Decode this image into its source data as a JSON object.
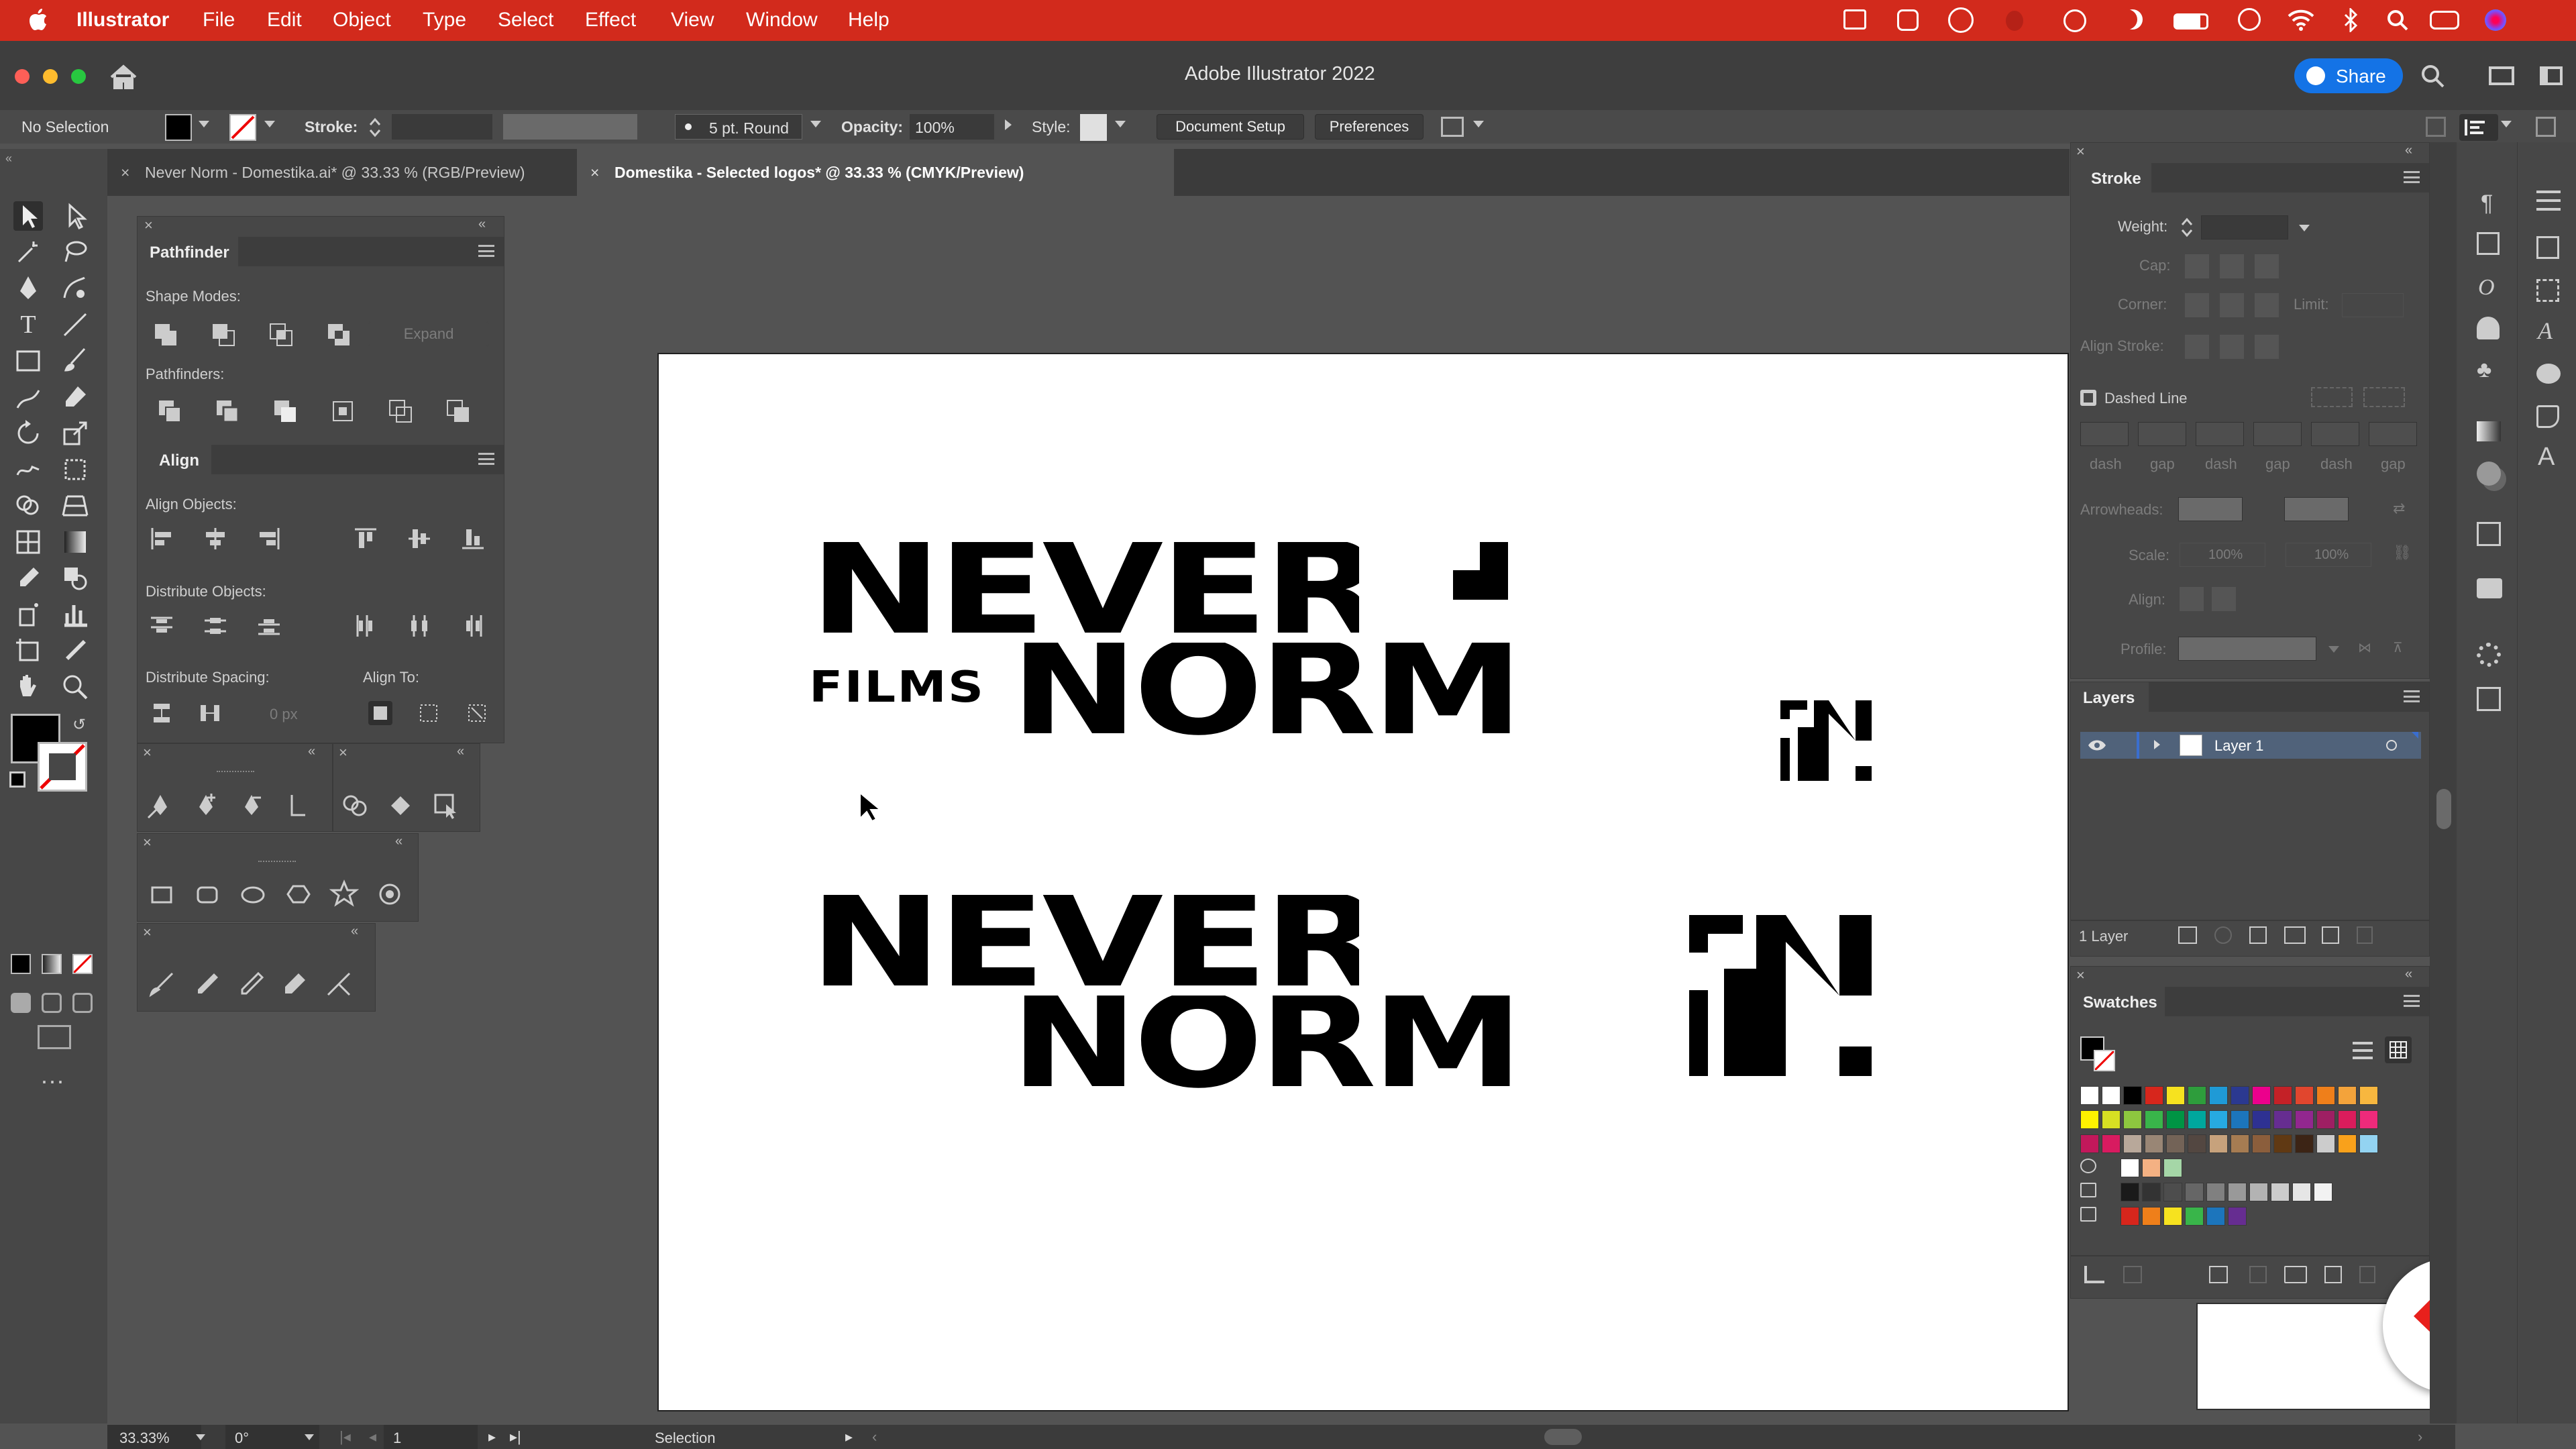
{
  "menubar": {
    "app": "Illustrator",
    "items": [
      "File",
      "Edit",
      "Object",
      "Type",
      "Select",
      "Effect",
      "View",
      "Window",
      "Help"
    ]
  },
  "window": {
    "title": "Adobe Illustrator 2022",
    "share_label": "Share"
  },
  "control_bar": {
    "selection": "No Selection",
    "stroke_label": "Stroke:",
    "brush": "5 pt. Round",
    "opacity_label": "Opacity:",
    "opacity_value": "100%",
    "style_label": "Style:",
    "document_setup": "Document Setup",
    "preferences": "Preferences"
  },
  "tabs": [
    {
      "label": "Never Norm - Domestika.ai* @ 33.33 % (RGB/Preview)",
      "active": false
    },
    {
      "label": "Domestika - Selected logos* @ 33.33 % (CMYK/Preview)",
      "active": true
    }
  ],
  "pathfinder": {
    "title": "Pathfinder",
    "shape_modes": "Shape Modes:",
    "expand": "Expand",
    "pathfinders": "Pathfinders:"
  },
  "align": {
    "title": "Align",
    "align_objects": "Align Objects:",
    "distribute_objects": "Distribute Objects:",
    "distribute_spacing": "Distribute Spacing:",
    "align_to": "Align To:",
    "spacing_value": "0 px"
  },
  "stroke_panel": {
    "title": "Stroke",
    "weight": "Weight:",
    "cap": "Cap:",
    "corner": "Corner:",
    "limit": "Limit:",
    "align_stroke": "Align Stroke:",
    "dashed_line": "Dashed Line",
    "dash_labels": [
      "dash",
      "gap",
      "dash",
      "gap",
      "dash",
      "gap"
    ],
    "arrowheads": "Arrowheads:",
    "scale": "Scale:",
    "scale_values": [
      "100%",
      "100%"
    ],
    "align": "Align:",
    "profile": "Profile:"
  },
  "layers": {
    "title": "Layers",
    "layer_name": "Layer 1",
    "count": "1 Layer"
  },
  "swatches": {
    "title": "Swatches",
    "rows": [
      [
        "#ffffff",
        "#ffffff",
        "#000000",
        "#d7261c",
        "#f6e21f",
        "#2e9d3c",
        "#1f9ad6",
        "#2b3990",
        "#ec008c",
        "#c42127",
        "#e1462e",
        "#ef7f1a",
        "#f3a33b",
        "#f7b73f"
      ],
      [
        "#fff200",
        "#d7df23",
        "#8dc63f",
        "#39b54a",
        "#009444",
        "#00a79d",
        "#27aae1",
        "#1c75bc",
        "#2e3192",
        "#662d91",
        "#92278f",
        "#9e1f63",
        "#da1c5c",
        "#ee2a7b"
      ],
      [
        "#c2185b",
        "#d81b60",
        "#b8a89a",
        "#998675",
        "#736357",
        "#534741",
        "#c7a27c",
        "#a67c52",
        "#8b5e3c",
        "#603913",
        "#3c2415",
        "#cccccc",
        "#f9a11b",
        "#93d3f1"
      ],
      [
        "#ffffff",
        "#f4b183",
        "#a5d6a7"
      ],
      [
        "#1a1a1a",
        "#333333",
        "#4d4d4d",
        "#666666",
        "#808080",
        "#999999",
        "#b3b3b3",
        "#cccccc",
        "#e6e6e6",
        "#f2f2f2"
      ],
      [
        "#d7261c",
        "#ef7f1a",
        "#f6e21f",
        "#39b54a",
        "#1c75bc",
        "#662d91"
      ]
    ]
  },
  "status_bar": {
    "zoom": "33.33%",
    "rotate": "0°",
    "artboard": "1",
    "tool": "Selection"
  },
  "artwork": {
    "logo_top_line1": "NEVER",
    "logo_top_films": "FILMS",
    "logo_top_line2": "NORM",
    "logo_bottom_line1": "NEVER",
    "logo_bottom_line2": "NORM"
  },
  "colors": {
    "menubar": "#d22a1c",
    "share": "#1473e6",
    "brand": "#e8201c"
  }
}
